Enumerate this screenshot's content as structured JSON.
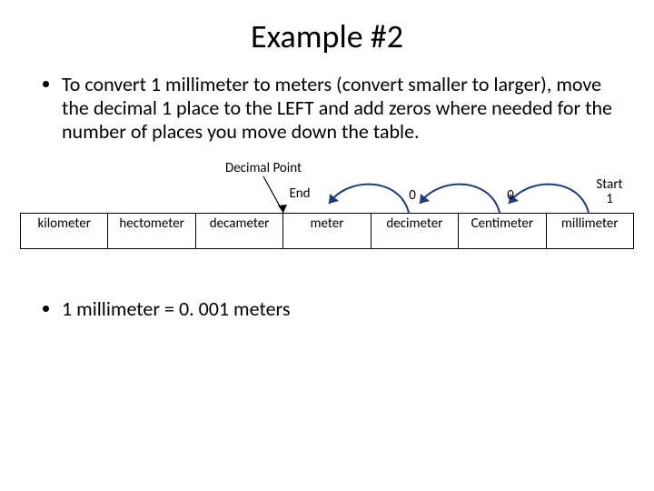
{
  "title": "Example #2",
  "bullets": {
    "b1": "To convert 1 millimeter to meters (convert smaller to larger), move the decimal 1 place to the LEFT and add zeros where needed for the number of places you move down the table."
  },
  "diagram": {
    "decimal_point_label": "Decimal Point",
    "end_label": "End",
    "start_label": "Start",
    "start_value": "1",
    "zero_a": "0",
    "zero_b": "0",
    "units": {
      "c1": "kilometer",
      "c2": "hectometer",
      "c3": "decameter",
      "c4": "meter",
      "c5": "decimeter",
      "c6": "Centimeter",
      "c7": "millimeter"
    }
  },
  "result": "1 millimeter = 0. 001 meters"
}
